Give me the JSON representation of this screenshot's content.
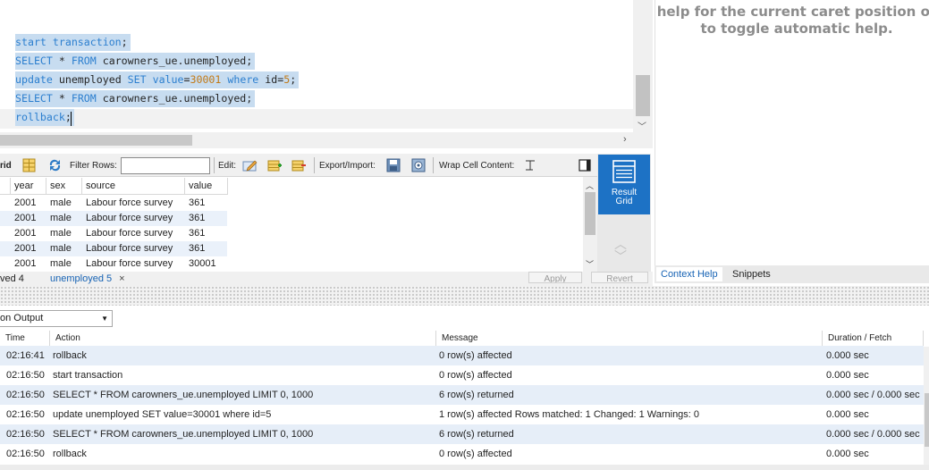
{
  "editor": {
    "lines": [
      {
        "parts": [
          {
            "t": "start transaction",
            "c": "kw"
          },
          {
            "t": ";",
            "c": "id"
          }
        ]
      },
      {
        "parts": [
          {
            "t": "SELECT",
            "c": "kw"
          },
          {
            "t": " * ",
            "c": "id"
          },
          {
            "t": "FROM",
            "c": "kw"
          },
          {
            "t": " carowners_ue.unemployed;",
            "c": "id"
          }
        ]
      },
      {
        "parts": [
          {
            "t": "update",
            "c": "kw"
          },
          {
            "t": " unemployed ",
            "c": "id"
          },
          {
            "t": "SET",
            "c": "kw"
          },
          {
            "t": " ",
            "c": "id"
          },
          {
            "t": "value",
            "c": "kw"
          },
          {
            "t": "=",
            "c": "id"
          },
          {
            "t": "30001",
            "c": "num"
          },
          {
            "t": " ",
            "c": "id"
          },
          {
            "t": "where",
            "c": "kw"
          },
          {
            "t": " id=",
            "c": "id"
          },
          {
            "t": "5",
            "c": "num"
          },
          {
            "t": ";",
            "c": "id"
          }
        ]
      },
      {
        "parts": [
          {
            "t": "SELECT",
            "c": "kw"
          },
          {
            "t": " * ",
            "c": "id"
          },
          {
            "t": "FROM",
            "c": "kw"
          },
          {
            "t": " carowners_ue.unemployed;",
            "c": "id"
          }
        ]
      },
      {
        "parts": [
          {
            "t": "rollback",
            "c": "kw"
          },
          {
            "t": ";",
            "c": "id"
          }
        ]
      }
    ]
  },
  "help": {
    "line1": "help for the current caret position or",
    "line2": "to toggle automatic help.",
    "tabs": {
      "context_help": "Context Help",
      "snippets": "Snippets"
    }
  },
  "toolbar": {
    "grid_label": "rid",
    "filter_label": "Filter Rows:",
    "filter_value": "",
    "edit_label": "Edit:",
    "export_label": "Export/Import:",
    "wrap_label": "Wrap Cell Content:"
  },
  "grid": {
    "columns": [
      "year",
      "sex",
      "source",
      "value"
    ],
    "rows": [
      [
        "2001",
        "male",
        "Labour force survey",
        "361"
      ],
      [
        "2001",
        "male",
        "Labour force survey",
        "361"
      ],
      [
        "2001",
        "male",
        "Labour force survey",
        "361"
      ],
      [
        "2001",
        "male",
        "Labour force survey",
        "361"
      ],
      [
        "2001",
        "male",
        "Labour force survey",
        "30001"
      ]
    ],
    "tabs": {
      "prev": "ved 4",
      "current": "unemployed 5",
      "close": "×"
    },
    "buttons": {
      "apply": "Apply",
      "revert": "Revert"
    }
  },
  "side_panel": {
    "result_grid_line1": "Result",
    "result_grid_line2": "Grid"
  },
  "output": {
    "selector": "on Output",
    "columns": {
      "time": "Time",
      "action": "Action",
      "message": "Message",
      "duration": "Duration / Fetch"
    },
    "rows": [
      {
        "time": "02:16:41",
        "action": "rollback",
        "message": "0 row(s) affected",
        "duration": "0.000 sec"
      },
      {
        "time": "02:16:50",
        "action": "start transaction",
        "message": "0 row(s) affected",
        "duration": "0.000 sec"
      },
      {
        "time": "02:16:50",
        "action": "SELECT * FROM carowners_ue.unemployed LIMIT 0, 1000",
        "message": "6 row(s) returned",
        "duration": "0.000 sec / 0.000 sec"
      },
      {
        "time": "02:16:50",
        "action": "update unemployed SET value=30001 where id=5",
        "message": "1 row(s) affected Rows matched: 1  Changed: 1  Warnings: 0",
        "duration": "0.000 sec"
      },
      {
        "time": "02:16:50",
        "action": "SELECT * FROM carowners_ue.unemployed LIMIT 0, 1000",
        "message": "6 row(s) returned",
        "duration": "0.000 sec / 0.000 sec"
      },
      {
        "time": "02:16:50",
        "action": "rollback",
        "message": "0 row(s) affected",
        "duration": "0.000 sec"
      }
    ]
  },
  "colors": {
    "accent": "#1d72c5",
    "selection": "#c7dcf0",
    "keyword": "#2c7fcf",
    "number": "#c27a17"
  }
}
